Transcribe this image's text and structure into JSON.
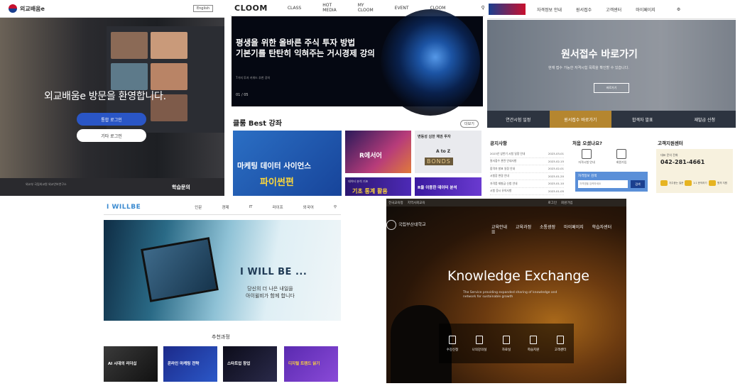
{
  "p1": {
    "site_name": "외교배움e",
    "lang_btn": "English",
    "welcome": "외교배움e 방문을 환영합니다.",
    "btn_login": "통합 로그인",
    "btn_other": "기타 로그인",
    "footer_text": "외교부 국립외교원 외교안보연구소",
    "help_title": "학습문의"
  },
  "p2": {
    "brand": "CLOOM",
    "nav": [
      "CLASS",
      "HOT MEDIA",
      "MY CLOOM",
      "EVENT",
      "CLOOM"
    ],
    "banner_line1": "평생을 위한 올바른 주식 투자 방법",
    "banner_line2": "기본기를 탄탄히 익혀주는 거시경제 강의",
    "banner_sub": "7가지 투자 키워드 추천 강의",
    "banner_counter": "01 / 05",
    "section_title": "클룸 Best 강좌",
    "more": "더보기",
    "card1_line1": "마케팅 데이터 사이언스",
    "card1_line2": "파이썬편",
    "card2_text": "R에서어",
    "card3_text": "변동성 심한 채권 투자",
    "card3_text2": "A to Z",
    "card3_bonds": "BONDS",
    "card4_text": "데이터 분석 기초",
    "card4_text2": "기초 통계 활용",
    "card5_text": "R을 이용한 데이터 분석"
  },
  "p3": {
    "nav": [
      "자격정보 안내",
      "원서접수",
      "고객센터",
      "마이페이지"
    ],
    "hero_title": "원서접수 바로가기",
    "hero_sub": "현재 접수 가능한 자격시험 목록을 확인할 수 있습니다.",
    "hero_btn": "바로가기",
    "tabs": [
      "연간시험 일정",
      "원서접수 바로가기",
      "합격자 발표",
      "재발급 신청"
    ],
    "notice_title": "공지사항",
    "notices": [
      {
        "t": "2023년 상반기 시험 일정 안내",
        "d": "2023-03-01"
      },
      {
        "t": "원서접수 관련 안내사항",
        "d": "2023-02-15"
      },
      {
        "t": "합격자 발표 일정 안내",
        "d": "2023-02-01"
      },
      {
        "t": "시험장 변경 안내",
        "d": "2023-01-20"
      },
      {
        "t": "자격증 재발급 신청 안내",
        "d": "2023-01-10"
      },
      {
        "t": "시험 응시 유의사항",
        "d": "2023-01-05"
      }
    ],
    "first_title": "처음 오셨나요?",
    "first_items": [
      "자격시험 안내",
      "회원가입"
    ],
    "search_label": "자격정보 검색",
    "search_placeholder": "자격명을 입력하세요",
    "search_btn": "검색",
    "cust_title": "고객지원센터",
    "cust_sub": "대표 문의 전화",
    "cust_phone": "042-281-4661",
    "cust_items": [
      "자주묻는 질문",
      "1:1 문의하기",
      "원격 지원"
    ]
  },
  "p4": {
    "brand": "I WILLBE",
    "nav": [
      "인문",
      "경제",
      "IT",
      "라이프",
      "외국어"
    ],
    "hero_title": "I WILL BE ...",
    "hero_sub1": "당신의 더 나은 내일을",
    "hero_sub2": "아이윌비가 함께 합니다",
    "rec_title": "추천과정",
    "thumbs": [
      "AI 시대의 리더십",
      "온라인 마케팅 전략",
      "스타트업 창업",
      "디지털 트렌드 읽기"
    ]
  },
  "p5": {
    "topbar": [
      "전국교육청",
      "지역사회교육",
      "로그인",
      "회원가입"
    ],
    "logo": "국립부산대학교",
    "nav": [
      "교육안내",
      "교육과정",
      "소통광장",
      "마이페이지",
      "학습자센터"
    ],
    "hero_title": "Knowledge Exchange",
    "hero_sub": "The Service providing expanded sharing of knowledge and network for sustainable growth",
    "menu": [
      "수강신청",
      "나의강의실",
      "자료실",
      "학습지원",
      "고객센터"
    ]
  }
}
